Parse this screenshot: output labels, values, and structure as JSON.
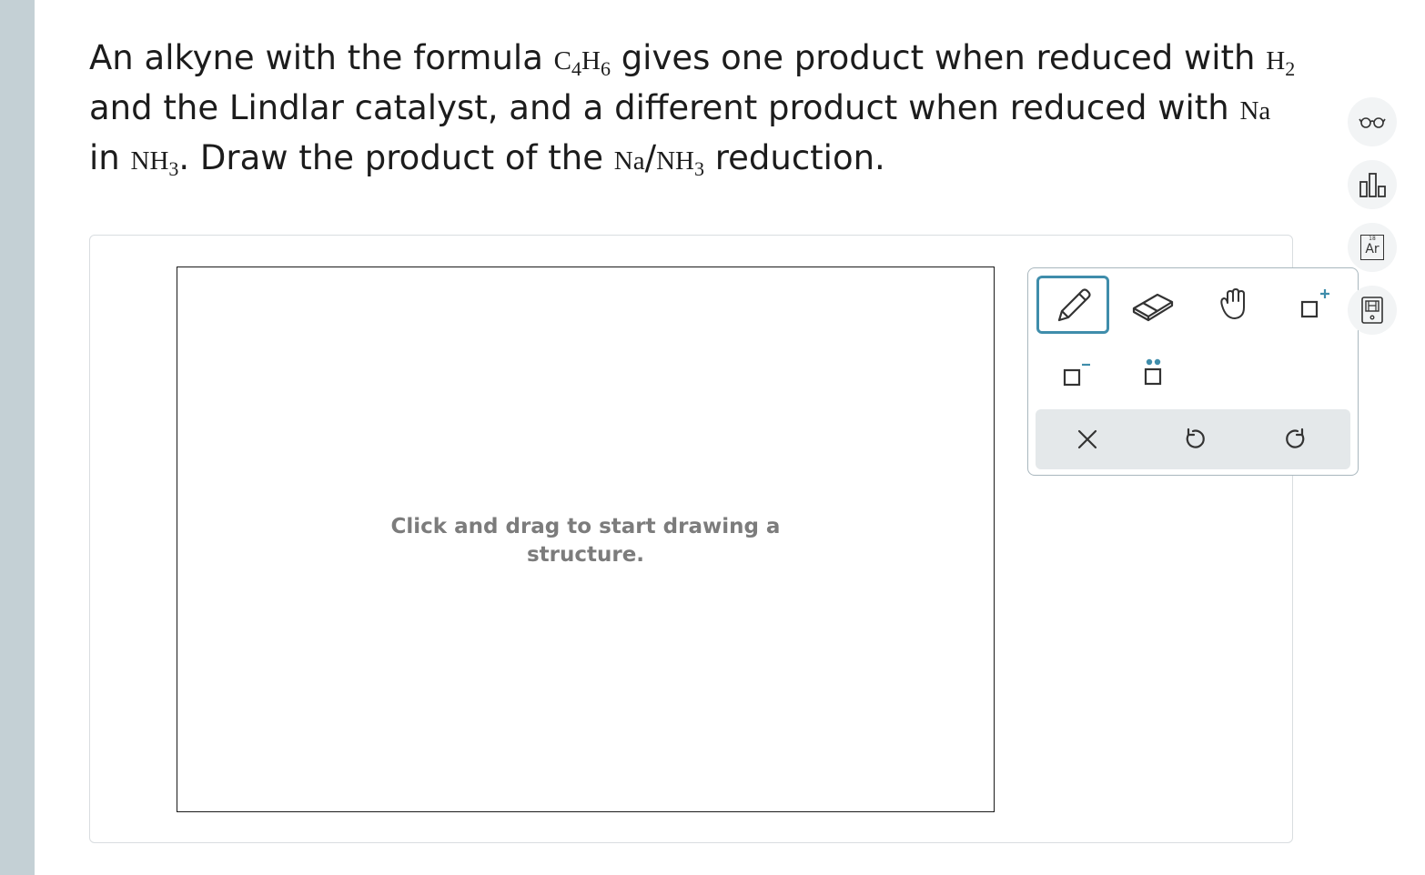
{
  "question": {
    "part1": "An alkyne with the formula ",
    "formula_c": "C",
    "formula_c_sub": "4",
    "formula_h": "H",
    "formula_h_sub": "6",
    "part2": " gives one product when reduced with ",
    "reagent_h": "H",
    "reagent_h_sub": "2",
    "part3": " and the Lindlar catalyst, and a different product when reduced with ",
    "reagent_na": "Na",
    "part4": " in ",
    "solvent_nh": "NH",
    "solvent_nh_sub": "3",
    "part5": ". Draw the product of the ",
    "reduction_na": "Na",
    "slash": "/",
    "reduction_nh": "NH",
    "reduction_nh_sub": "3",
    "part6": " reduction."
  },
  "canvas": {
    "hint_line1": "Click and drag to start drawing a",
    "hint_line2": "structure."
  },
  "toolbar": {
    "tools": [
      {
        "icon": "pencil-icon",
        "active": true
      },
      {
        "icon": "eraser-icon",
        "active": false
      },
      {
        "icon": "hand-icon",
        "active": false
      },
      {
        "icon": "add-charge-icon",
        "active": false
      },
      {
        "icon": "remove-charge-icon",
        "active": false
      },
      {
        "icon": "lone-pair-icon",
        "active": false
      }
    ],
    "actions": [
      "clear-icon",
      "undo-icon",
      "redo-icon"
    ],
    "accent_color": "#3f8dab"
  },
  "side_tools": {
    "periodic_number": "18",
    "periodic_symbol": "Ar",
    "icons": [
      "glasses-icon",
      "chart-icon",
      "periodic-table-icon",
      "calculator-icon"
    ]
  }
}
